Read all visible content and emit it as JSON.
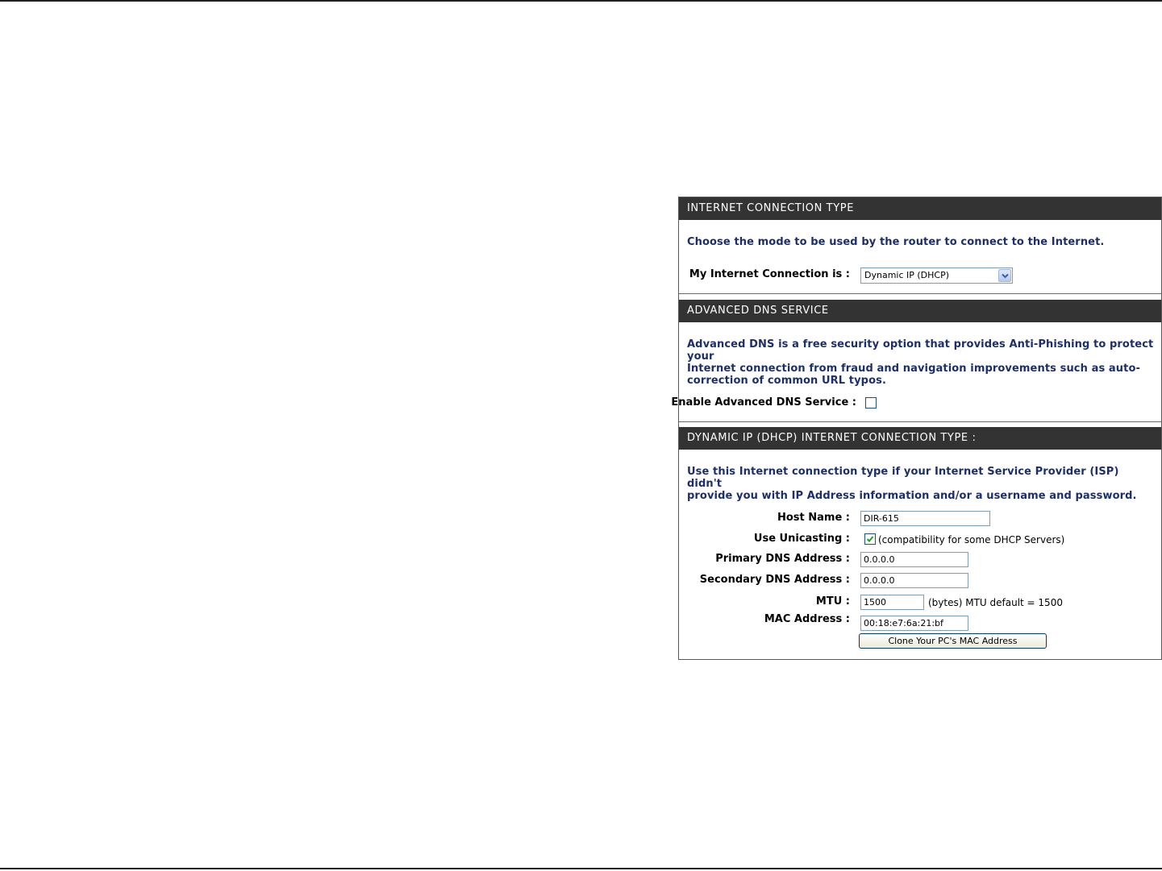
{
  "connection_type": {
    "header": "INTERNET CONNECTION TYPE",
    "description": "Choose the mode to be used by the router to connect to the Internet.",
    "label": "My Internet Connection is :",
    "selected": "Dynamic IP (DHCP)"
  },
  "advanced_dns": {
    "header": "ADVANCED DNS SERVICE",
    "description_lines": [
      "Advanced DNS is a free security option that provides Anti-Phishing to protect your",
      "Internet connection from fraud and navigation improvements such as auto-",
      "correction of common URL typos."
    ],
    "enable_label": "Enable Advanced DNS Service :",
    "enabled": false
  },
  "dhcp": {
    "header": "DYNAMIC IP (DHCP) INTERNET CONNECTION TYPE :",
    "description_lines": [
      "Use this Internet connection type if your Internet Service Provider (ISP) didn't",
      "provide you with IP Address information and/or a username and password."
    ],
    "host_name_label": "Host Name :",
    "host_name_value": "DIR-615",
    "unicasting_label": "Use Unicasting :",
    "unicasting_checked": true,
    "unicasting_note": "(compatibility for some DHCP Servers)",
    "primary_dns_label": "Primary DNS Address :",
    "primary_dns_value": "0.0.0.0",
    "secondary_dns_label": "Secondary DNS Address :",
    "secondary_dns_value": "0.0.0.0",
    "mtu_label": "MTU :",
    "mtu_value": "1500",
    "mtu_note": "(bytes) MTU default = 1500",
    "mac_label": "MAC Address :",
    "mac_value": "00:18:e7:6a:21:bf",
    "clone_button": "Clone Your PC's MAC Address"
  },
  "colors": {
    "header_bg": "#333333",
    "description_text": "#1c2f6b",
    "input_border": "#7f9db9",
    "check_mark": "#21a121"
  },
  "icons": {
    "dropdown": "chevron-down-icon",
    "check": "check-icon"
  }
}
